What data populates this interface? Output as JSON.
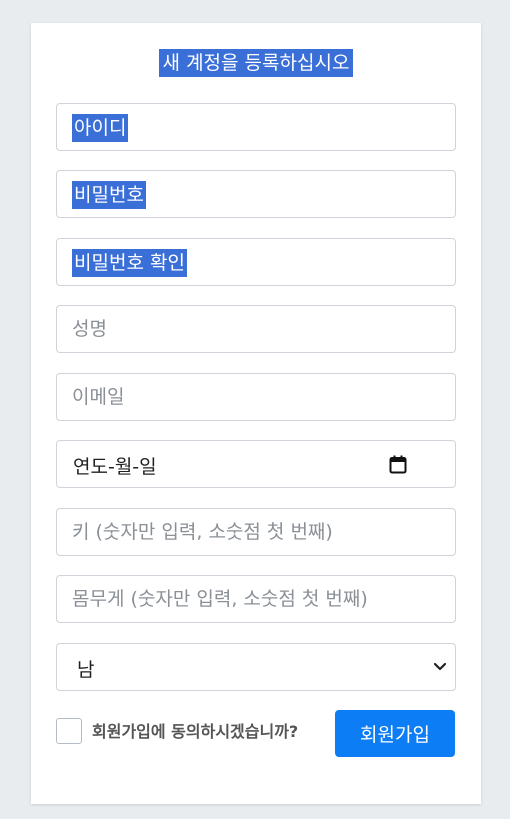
{
  "form": {
    "title": "새 계정을 등록하십시오",
    "username": {
      "value": "아이디"
    },
    "password": {
      "value": "비밀번호"
    },
    "password_confirm": {
      "value": "비밀번호 확인"
    },
    "name": {
      "placeholder": "성명"
    },
    "email": {
      "placeholder": "이메일"
    },
    "birthdate": {
      "display": "연도-월-일",
      "icon": "calendar-icon"
    },
    "height": {
      "placeholder": "키 (숫자만 입력, 소숫점 첫 번째)"
    },
    "weight": {
      "placeholder": "몸무게 (숫자만 입력, 소숫점 첫 번째)"
    },
    "gender": {
      "selected": "남",
      "icon": "chevron-down-icon"
    },
    "agree": {
      "label": "회원가입에 동의하시겠습니까?",
      "checked": false
    },
    "submit_label": "회원가입"
  },
  "colors": {
    "background": "#e9ecef",
    "selection": "#3b6fd8",
    "primary_button": "#0d7df5"
  }
}
